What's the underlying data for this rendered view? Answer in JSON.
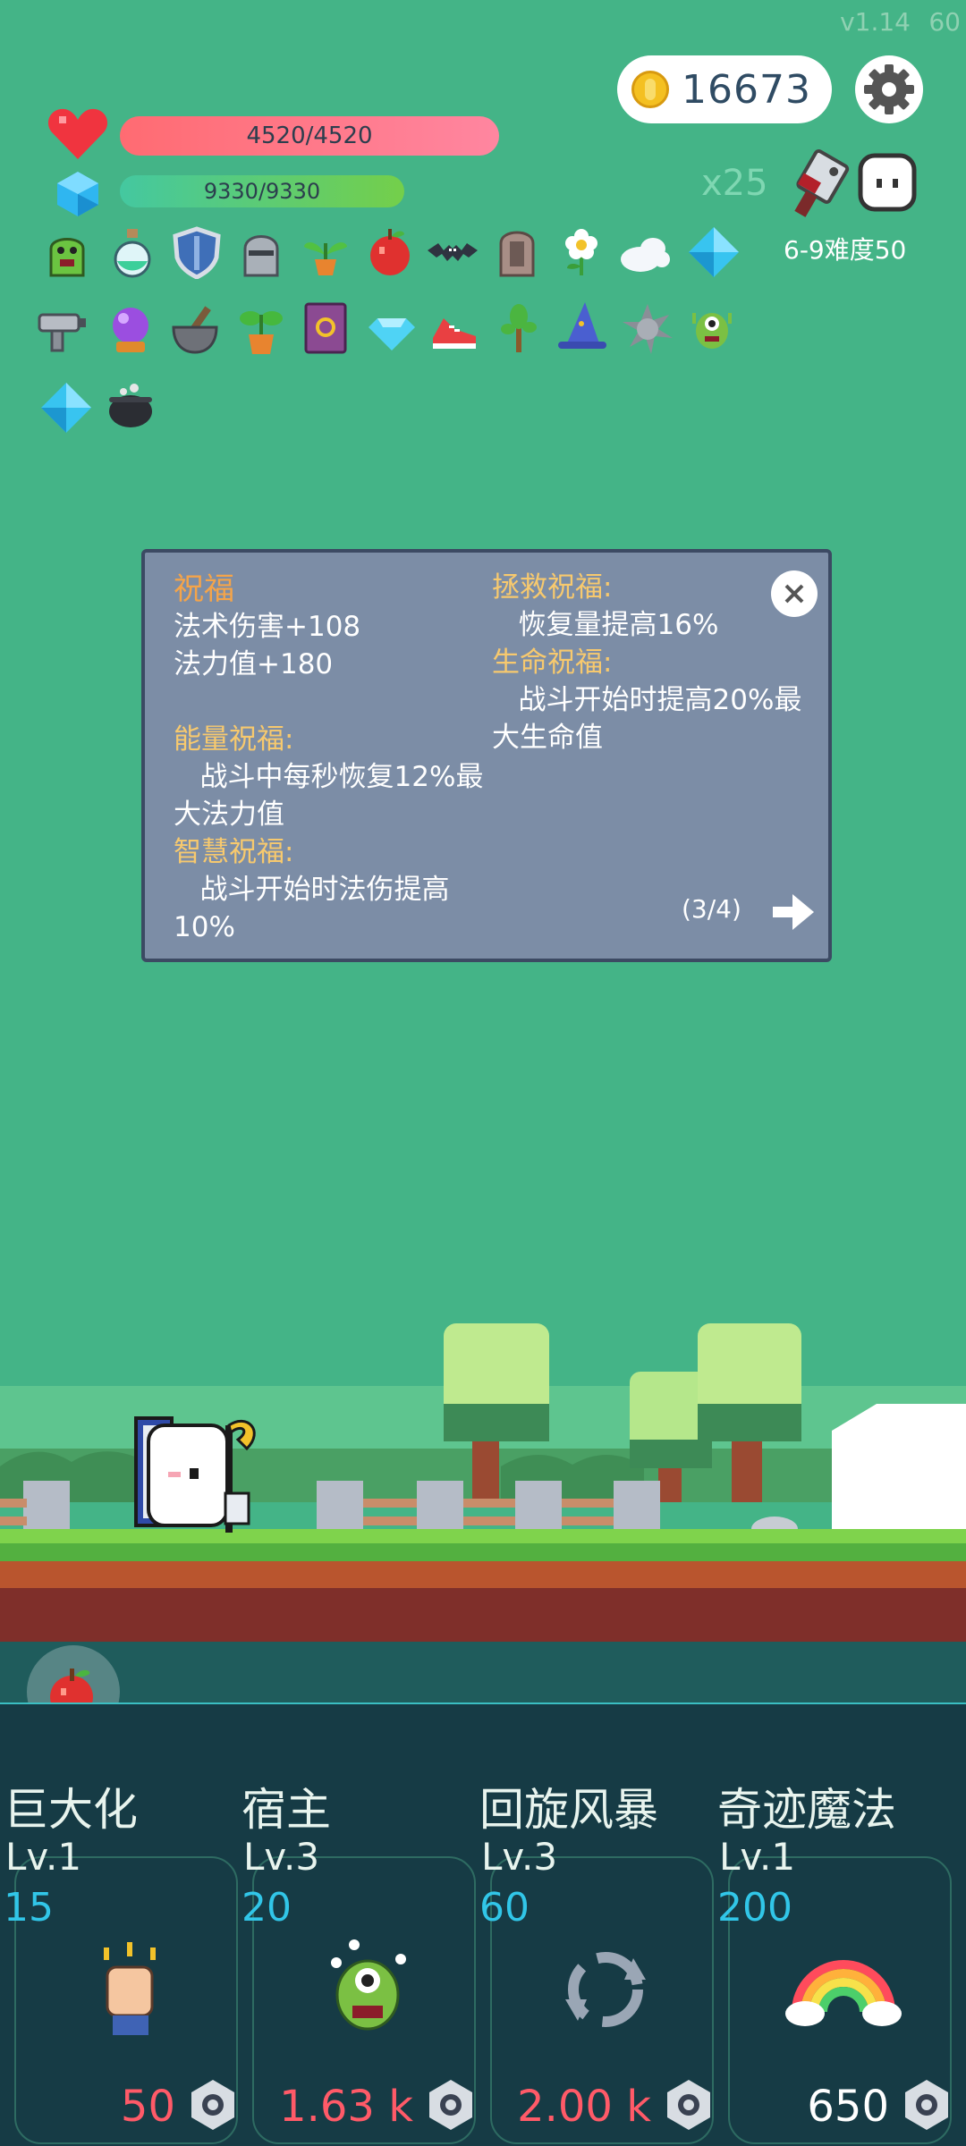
{
  "app": {
    "version": "v1.14",
    "fps": "60"
  },
  "currency": {
    "coins": "16673"
  },
  "player": {
    "hp": "4520/4520",
    "mp": "9330/9330"
  },
  "stage": {
    "multiplier": "x25",
    "difficulty": "6-9难度50"
  },
  "items": [
    "green-monster-icon",
    "potion-icon",
    "shield-icon",
    "helmet-icon",
    "sprout-pot-icon",
    "apple-icon",
    "bat-icon",
    "tombstone-icon",
    "flower-icon",
    "cloud-icon",
    "diamond-icon",
    "raygun-icon",
    "crystal-ball-icon",
    "mortar-icon",
    "plant-pot-icon",
    "spellbook-icon",
    "gem-icon",
    "sneaker-icon",
    "tree-icon",
    "wizard-hat-icon",
    "spiked-ball-icon",
    "eye-monster-icon",
    "diamond-icon",
    "cauldron-icon"
  ],
  "panel": {
    "title": "祝福",
    "left_lines": [
      {
        "text": "法术伤害+108",
        "hd": false
      },
      {
        "text": "法力值+180",
        "hd": false
      },
      {
        "text": "",
        "hd": false
      },
      {
        "text": "能量祝福:",
        "hd": true
      },
      {
        "text": "   战斗中每秒恢复12%最",
        "hd": false
      },
      {
        "text": "大法力值",
        "hd": false
      },
      {
        "text": "智慧祝福:",
        "hd": true
      },
      {
        "text": "   战斗开始时法伤提高",
        "hd": false
      },
      {
        "text": "10%",
        "hd": false
      }
    ],
    "right_lines": [
      {
        "text": "拯救祝福:",
        "hd": true
      },
      {
        "text": "   恢复量提高16%",
        "hd": false
      },
      {
        "text": "生命祝福:",
        "hd": true
      },
      {
        "text": "   战斗开始时提高20%最",
        "hd": false
      },
      {
        "text": "大生命值",
        "hd": false
      }
    ],
    "page": "(3/4)"
  },
  "skills": [
    {
      "name": "巨大化",
      "level": "Lv.1",
      "cost": "15",
      "price": "50",
      "price_color": "#ff5a68",
      "icon": "fist-icon"
    },
    {
      "name": "宿主",
      "level": "Lv.3",
      "cost": "20",
      "price": "1.63 k",
      "price_color": "#ff5a68",
      "icon": "eye-monster-icon"
    },
    {
      "name": "回旋风暴",
      "level": "Lv.3",
      "cost": "60",
      "price": "2.00 k",
      "price_color": "#ff5a68",
      "icon": "cyclone-icon"
    },
    {
      "name": "奇迹魔法",
      "level": "Lv.1",
      "cost": "200",
      "price": "650",
      "price_color": "#ffffff",
      "icon": "rainbow-icon"
    }
  ],
  "colors": {
    "background": "#44b487",
    "panel": "#7c8da6",
    "heading": "#f7c96e",
    "cost": "#31c6e8"
  }
}
